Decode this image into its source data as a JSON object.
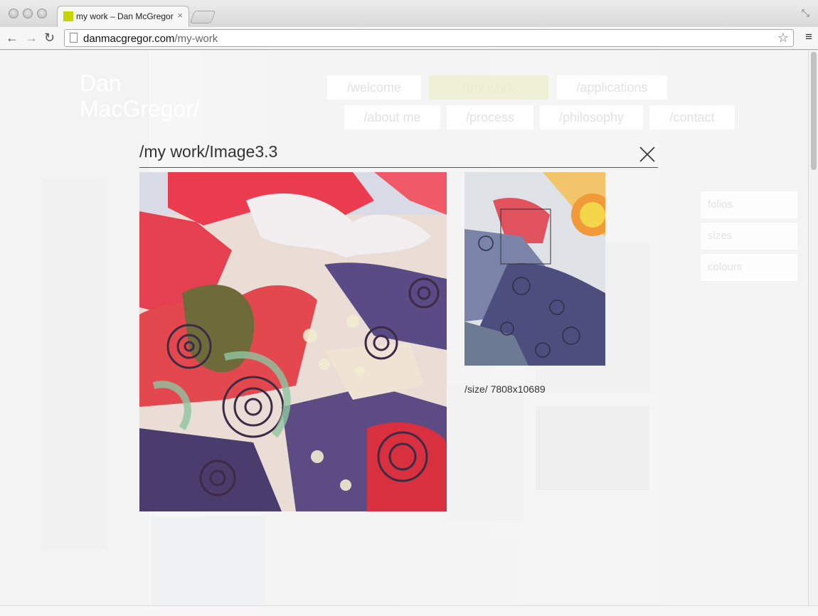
{
  "browser": {
    "tab_title": "my work – Dan McGregor",
    "tab_close": "×",
    "url_domain": "danmacgregor.com",
    "url_path": "/my-work"
  },
  "site": {
    "logo_line1": "Dan",
    "logo_line2": "MacGregor/",
    "nav_row1": [
      "/welcome",
      "/my work",
      "/applications"
    ],
    "nav_row2": [
      "/about me",
      "/process",
      "/philosophy",
      "/contact"
    ],
    "side_menu": [
      "folios",
      "sizes",
      "colours"
    ]
  },
  "modal": {
    "title": "/my work/Image3.3",
    "size_label": "/size/",
    "size_value": "7808x10689"
  },
  "colors": {
    "accent": "#c6d400"
  }
}
